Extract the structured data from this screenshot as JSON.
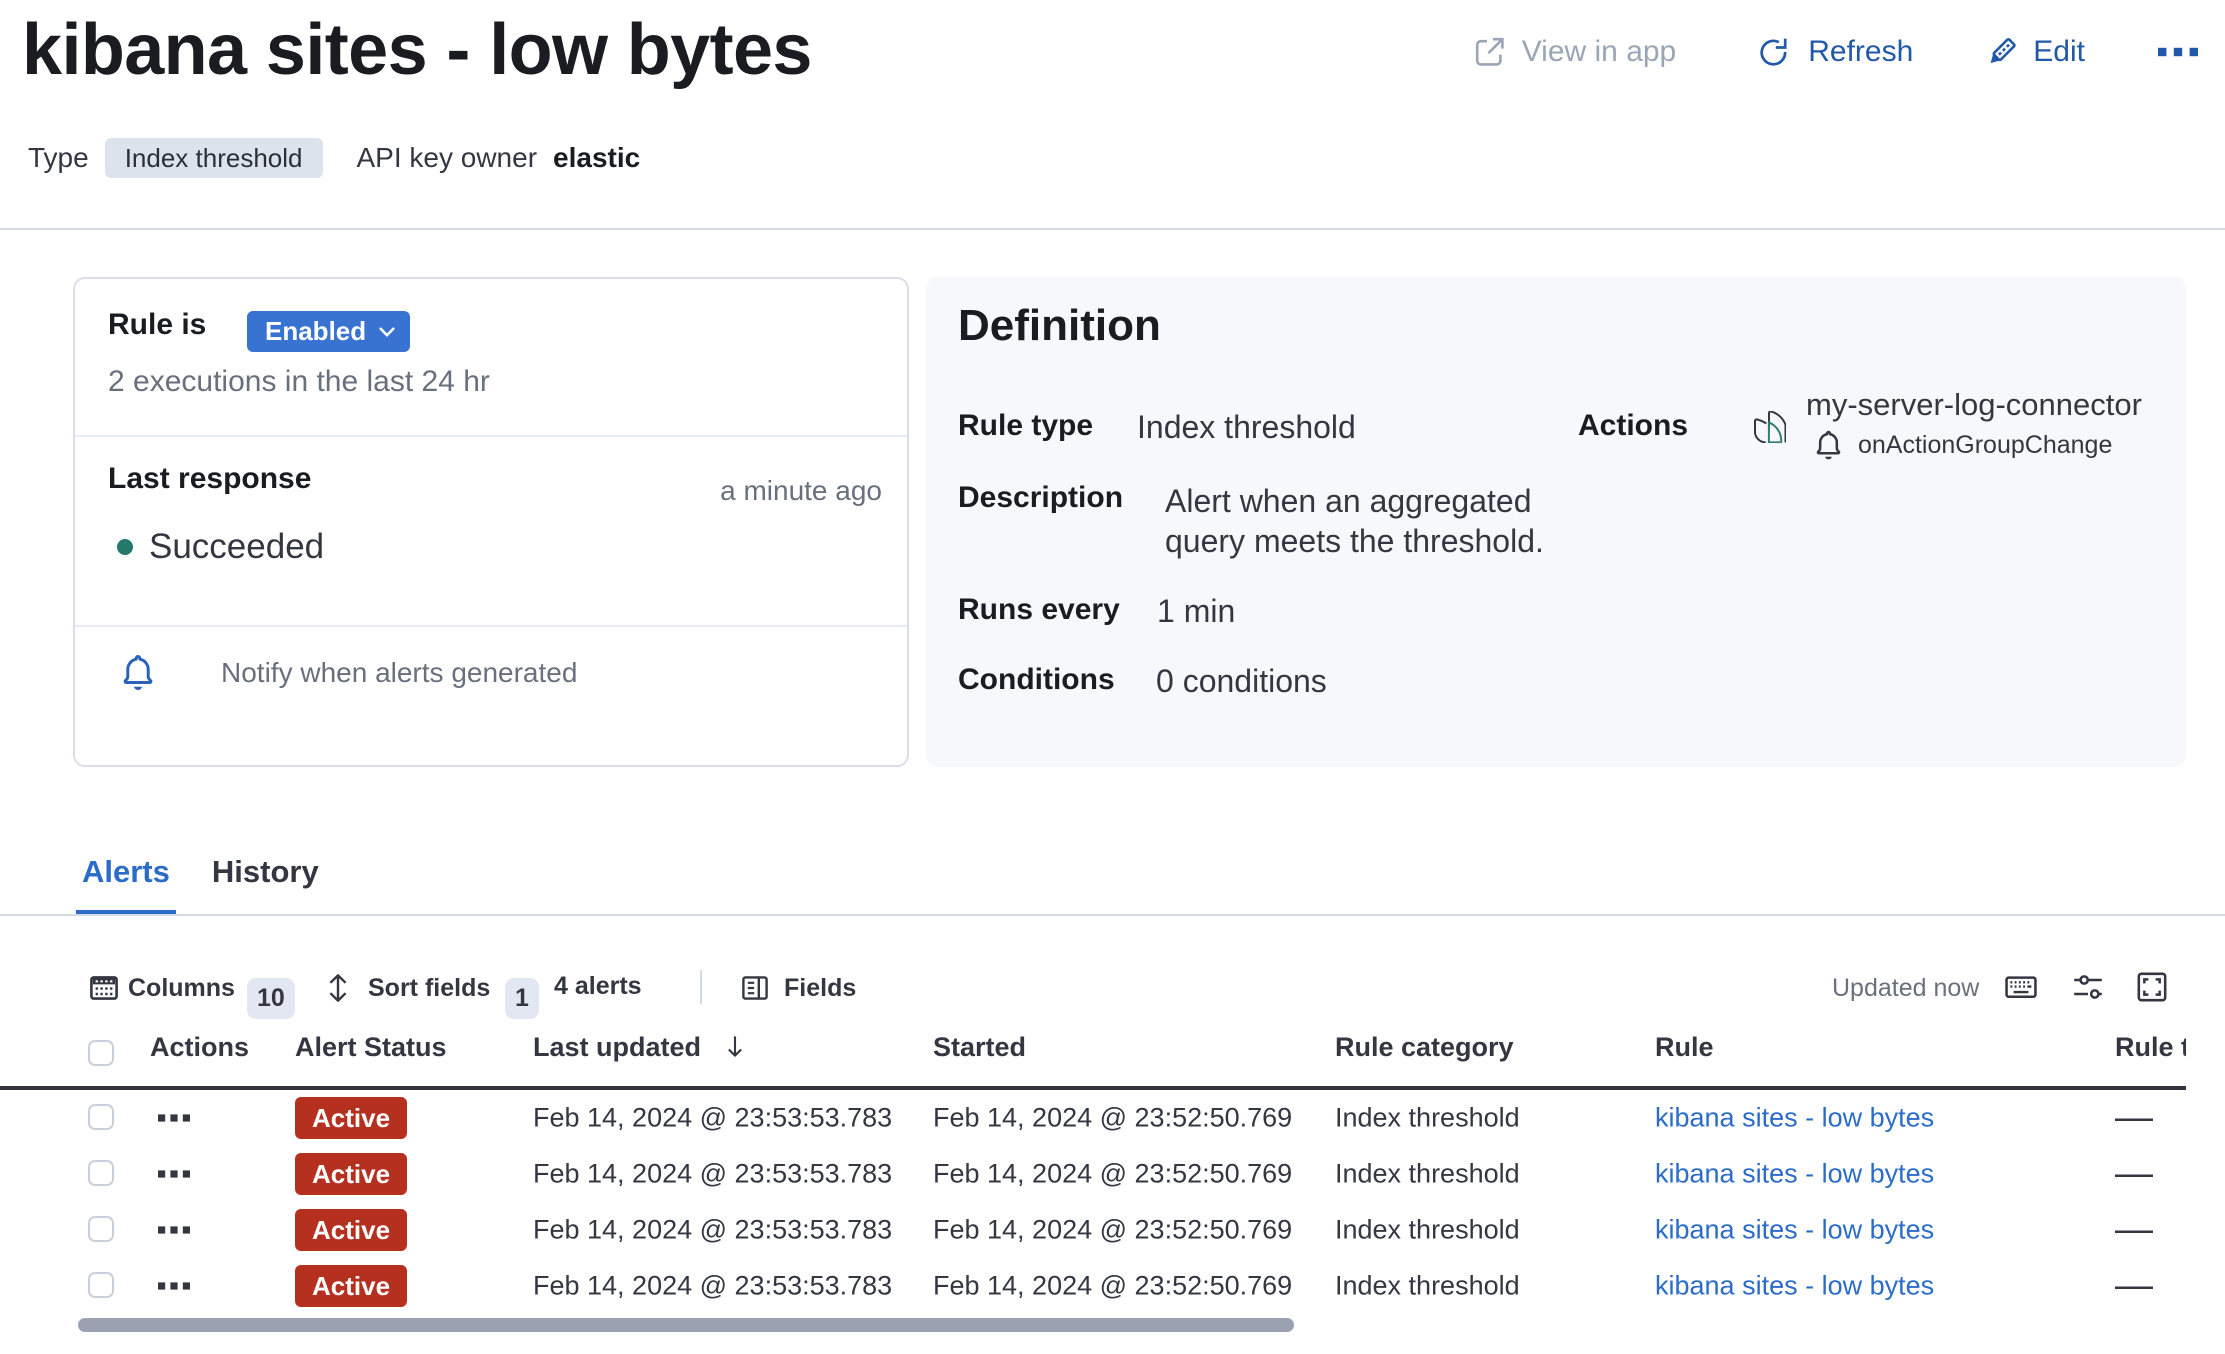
{
  "page": {
    "title": "kibana sites - low bytes"
  },
  "header": {
    "view_in_app_label": "View in app",
    "refresh_label": "Refresh",
    "edit_label": "Edit"
  },
  "meta": {
    "type_label": "Type",
    "type_value": "Index threshold",
    "api_key_label": "API key owner",
    "api_key_value": "elastic"
  },
  "status_panel": {
    "rule_is_label": "Rule is",
    "enabled_label": "Enabled",
    "executions_text": "2 executions in the last 24 hr",
    "last_response_label": "Last response",
    "last_response_time": "a minute ago",
    "last_response_status": "Succeeded",
    "notify_text": "Notify when alerts generated"
  },
  "definition": {
    "title": "Definition",
    "rule_type_label": "Rule type",
    "rule_type_value": "Index threshold",
    "description_label": "Description",
    "description_value": "Alert when an aggregated query meets the threshold.",
    "runs_every_label": "Runs every",
    "runs_every_value": "1 min",
    "conditions_label": "Conditions",
    "conditions_value": "0 conditions",
    "actions_label": "Actions",
    "connector_name": "my-server-log-connector",
    "connector_action_group": "onActionGroupChange"
  },
  "tabs": [
    {
      "label": "Alerts",
      "active": true
    },
    {
      "label": "History",
      "active": false
    }
  ],
  "toolbar": {
    "columns_label": "Columns",
    "columns_count": "10",
    "sort_fields_label": "Sort fields",
    "sort_count": "1",
    "alerts_count_label": "4 alerts",
    "fields_label": "Fields",
    "updated_label": "Updated now"
  },
  "table": {
    "columns": [
      "Actions",
      "Alert Status",
      "Last updated",
      "Started",
      "Rule category",
      "Rule",
      "Rule tags"
    ],
    "rows": [
      {
        "status": "Active",
        "updated": "Feb 14, 2024 @ 23:53:53.783",
        "started": "Feb 14, 2024 @ 23:52:50.769",
        "category": "Index threshold",
        "rule": "kibana sites - low bytes",
        "tags": "—"
      },
      {
        "status": "Active",
        "updated": "Feb 14, 2024 @ 23:53:53.783",
        "started": "Feb 14, 2024 @ 23:52:50.769",
        "category": "Index threshold",
        "rule": "kibana sites - low bytes",
        "tags": "—"
      },
      {
        "status": "Active",
        "updated": "Feb 14, 2024 @ 23:53:53.783",
        "started": "Feb 14, 2024 @ 23:52:50.769",
        "category": "Index threshold",
        "rule": "kibana sites - low bytes",
        "tags": "—"
      },
      {
        "status": "Active",
        "updated": "Feb 14, 2024 @ 23:53:53.783",
        "started": "Feb 14, 2024 @ 23:52:50.769",
        "category": "Index threshold",
        "rule": "kibana sites - low bytes",
        "tags": "—"
      }
    ]
  },
  "colors": {
    "primary_text_blue": "#2159a8",
    "link_blue": "#2a6cc8",
    "enabled_badge_blue": "#3873d1",
    "active_badge_red": "#b5301f",
    "success_teal": "#25796a",
    "text_dark": "#343741",
    "text_subdued": "#69707d"
  },
  "icons": {
    "header": [
      "external-link-icon",
      "refresh-icon",
      "pencil-icon",
      "boxes-horizontal-icon"
    ],
    "status_panel": [
      "bell-icon"
    ],
    "definition": [
      "logs-connector-icon",
      "bell-icon"
    ],
    "toolbar": [
      "table-columns-icon",
      "sort-icon",
      "fields-selector-icon",
      "keyboard-icon",
      "controls-icon",
      "fullscreen-icon"
    ],
    "table": [
      "sort-arrow-down-icon",
      "boxes-horizontal-icon"
    ]
  }
}
